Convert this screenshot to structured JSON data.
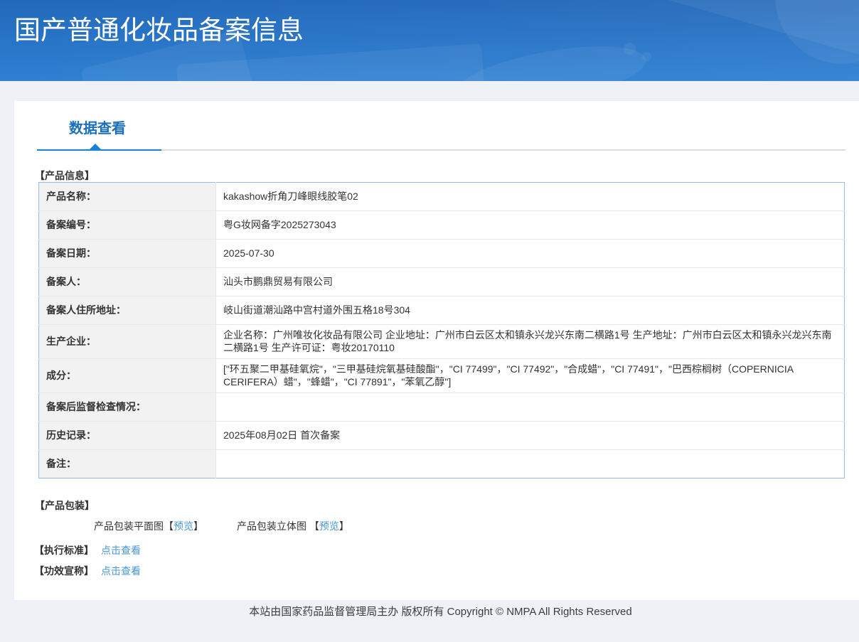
{
  "colors": {
    "banner_gradient_start": "#2065b5",
    "banner_gradient_end": "#3287d8",
    "page_background": "#eef1f6",
    "tab_text": "#1c6fb8",
    "tab_rule_active": "#1583d6",
    "table_outer_border": "#9cbae0",
    "table_inner_border": "#e8e8e8",
    "label_cell_background": "#f2f2f2",
    "link": "#4696d9",
    "text": "#333333"
  },
  "banner": {
    "title": "国产普通化妆品备案信息"
  },
  "tabs": {
    "data_view": "数据查看"
  },
  "product_info": {
    "heading": "【产品信息】",
    "rows": [
      {
        "label": "产品名称：",
        "value": "kakashow折角刀峰眼线胶笔02"
      },
      {
        "label": "备案编号：",
        "value": "粤G妆网备字2025273043"
      },
      {
        "label": "备案日期：",
        "value": "2025-07-30"
      },
      {
        "label": "备案人：",
        "value": "汕头市鹏鼎贸易有限公司"
      },
      {
        "label": "备案人住所地址：",
        "value": "岐山街道潮汕路中宫村道外围五格18号304"
      },
      {
        "label": "生产企业：",
        "value": "企业名称：广州唯妆化妆品有限公司 企业地址：广州市白云区太和镇永兴龙兴东南二横路1号 生产地址：广州市白云区太和镇永兴龙兴东南二横路1号 生产许可证：粤妆20170110"
      },
      {
        "label": "成分：",
        "value": "[\"环五聚二甲基硅氧烷\"，\"三甲基硅烷氧基硅酸酯\"，\"CI 77499\"，\"CI 77492\"，\"合成蜡\"，\"CI 77491\"，\"巴西棕榈树（COPERNICIA CERIFERA）蜡\"，\"蜂蜡\"，\"CI 77891\"，\"苯氧乙醇\"]"
      },
      {
        "label": "备案后监督检查情况：",
        "value": ""
      },
      {
        "label": "历史记录：",
        "value": "2025年08月02日 首次备案"
      },
      {
        "label": "备注：",
        "value": ""
      }
    ]
  },
  "packaging": {
    "heading": "【产品包装】",
    "items": [
      {
        "label": "产品包装平面图",
        "bracket_open": "【",
        "link": "预览",
        "bracket_close": "】"
      },
      {
        "label": "产品包装立体图 ",
        "bracket_open": "【",
        "link": "预览",
        "bracket_close": "】"
      }
    ]
  },
  "standards": {
    "heading": "【执行标准】",
    "link": "点击查看"
  },
  "efficacy": {
    "heading": "【功效宣称】",
    "link": "点击查看"
  },
  "footer": {
    "text": "本站由国家药品监督管理局主办 版权所有 Copyright © NMPA All Rights Reserved"
  }
}
